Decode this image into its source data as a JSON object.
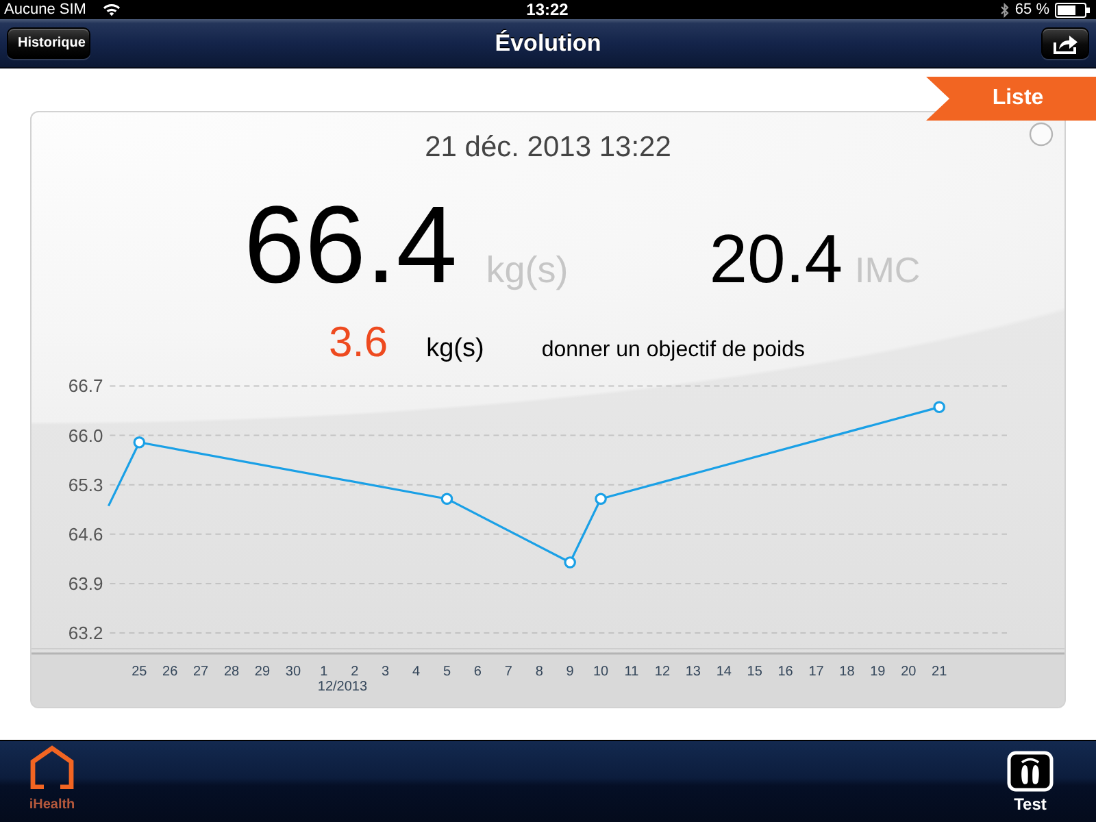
{
  "status_bar": {
    "carrier": "Aucune SIM",
    "time": "13:22",
    "battery": "65 %"
  },
  "nav_bar": {
    "back_button": "Historique",
    "title": "Évolution"
  },
  "list_tab": {
    "label": "Liste"
  },
  "card": {
    "datetime": "21 déc. 2013 13:22",
    "weight": "66.4",
    "weight_unit": "kg(s)",
    "bmi": "20.4",
    "bmi_unit": "IMC",
    "difference": "3.6",
    "difference_unit": "kg(s)",
    "goal_link": "donner un objectif de poids",
    "chart_data": {
      "type": "line",
      "grid": true,
      "categories": [
        null,
        "25",
        "26",
        "27",
        "28",
        "29",
        "30",
        "1",
        "2",
        "3",
        "4",
        "5",
        "6",
        "7",
        "8",
        "9",
        "10",
        "11",
        "12",
        "13",
        "14",
        "15",
        "16",
        "17",
        "18",
        "19",
        "20",
        "21"
      ],
      "series": [
        {
          "color": "#1aa0e6",
          "marker": "circle",
          "values": [
            65.0,
            65.9,
            null,
            null,
            null,
            null,
            null,
            null,
            null,
            null,
            null,
            65.1,
            null,
            null,
            null,
            64.2,
            65.1,
            null,
            null,
            null,
            null,
            null,
            null,
            null,
            null,
            null,
            null,
            66.4
          ]
        }
      ],
      "ylim": [
        63.2,
        66.7
      ],
      "yticks": [
        {
          "value": 66.7,
          "label": "66.7"
        },
        {
          "value": 66.0,
          "label": "66.0"
        },
        {
          "value": 65.3,
          "label": "65.3"
        },
        {
          "value": 64.6,
          "label": "64.6"
        },
        {
          "value": 63.9,
          "label": "63.9"
        },
        {
          "value": 63.2,
          "label": "63.2"
        }
      ],
      "annotations": [
        "12/2013"
      ]
    }
  },
  "tab_bar": {
    "home": "iHealth",
    "test": "Test"
  }
}
